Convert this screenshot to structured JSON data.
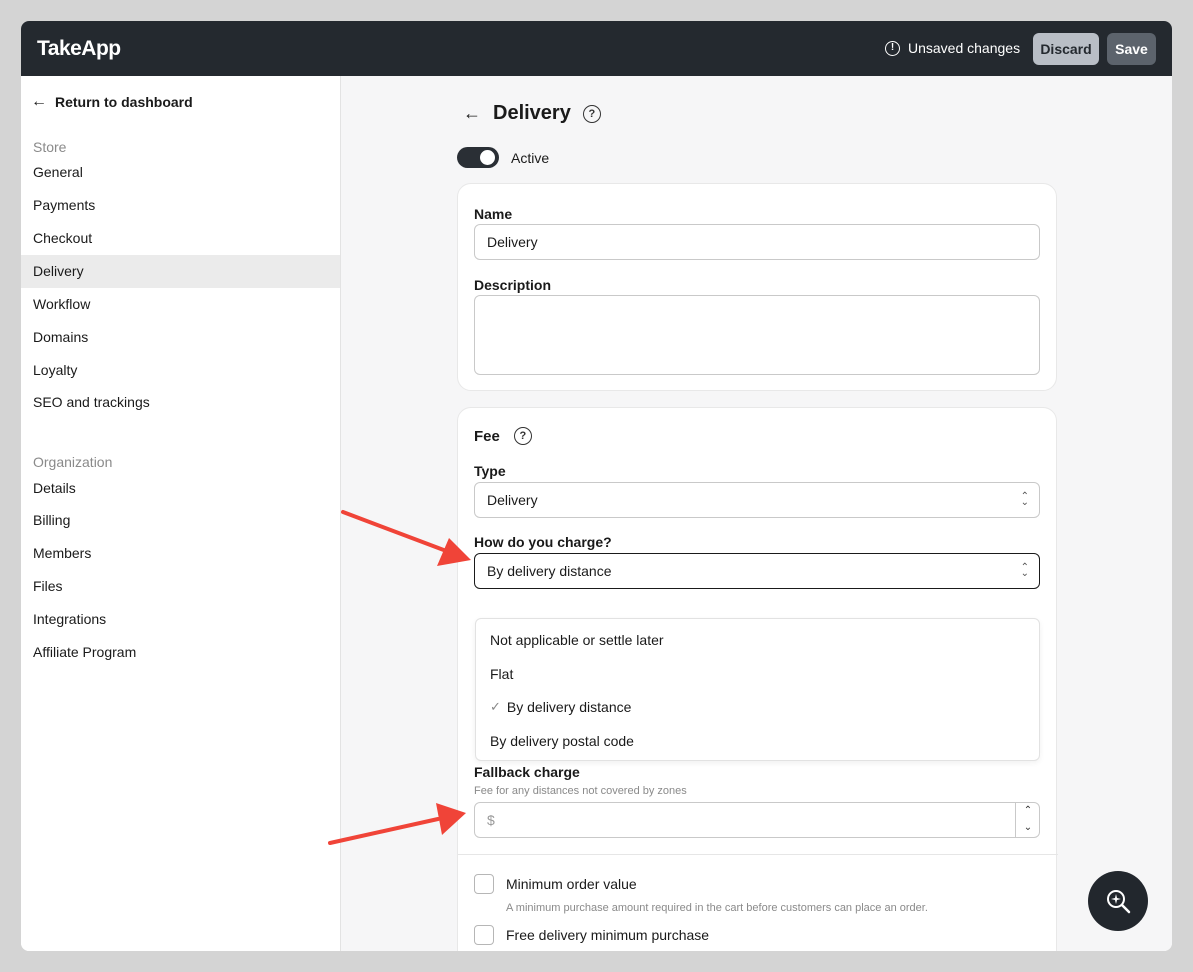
{
  "app": {
    "logo": "TakeApp"
  },
  "topbar": {
    "unsaved_text": "Unsaved changes",
    "discard_label": "Discard",
    "save_label": "Save"
  },
  "sidebar": {
    "back_label": "Return to dashboard",
    "store_section": "Store",
    "store_items": [
      "General",
      "Payments",
      "Checkout",
      "Delivery",
      "Workflow",
      "Domains",
      "Loyalty",
      "SEO and trackings"
    ],
    "org_section": "Organization",
    "org_items": [
      "Details",
      "Billing",
      "Members",
      "Files",
      "Integrations",
      "Affiliate Program"
    ],
    "active_item": "Delivery"
  },
  "page": {
    "title": "Delivery",
    "active_label": "Active",
    "active_toggle_on": true
  },
  "details_card": {
    "name_label": "Name",
    "name_value": "Delivery",
    "description_label": "Description",
    "description_value": ""
  },
  "fee_card": {
    "title": "Fee",
    "type_label": "Type",
    "type_value": "Delivery",
    "charge_label": "How do you charge?",
    "charge_value": "By delivery distance",
    "charge_options": [
      "Not applicable or settle later",
      "Flat",
      "By delivery distance",
      "By delivery postal code"
    ],
    "selected_option": "By delivery distance",
    "fallback_label": "Fallback charge",
    "fallback_help": "Fee for any distances not covered by zones",
    "fallback_placeholder": "$",
    "min_order_label": "Minimum order value",
    "min_order_help": "A minimum purchase amount required in the cart before customers can place an order.",
    "free_delivery_label": "Free delivery minimum purchase"
  },
  "colors": {
    "topbar": "#24292f",
    "annotation_arrow": "#f04438",
    "active_bg": "#ebebeb"
  }
}
